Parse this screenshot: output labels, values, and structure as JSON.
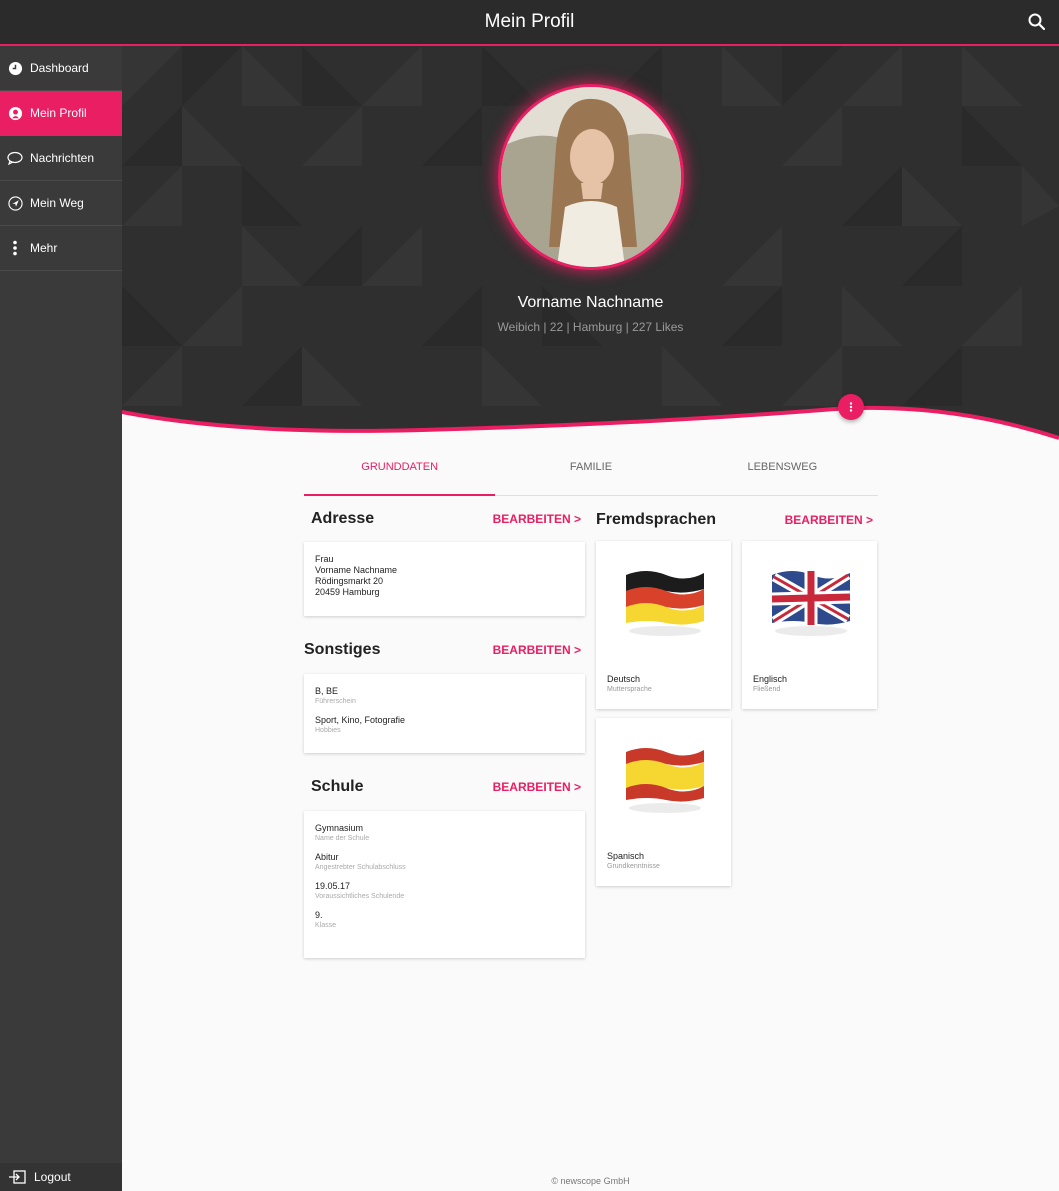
{
  "header": {
    "title": "Mein Profil"
  },
  "sidebar": {
    "items": [
      {
        "label": "Dashboard"
      },
      {
        "label": "Mein Profil"
      },
      {
        "label": "Nachrichten"
      },
      {
        "label": "Mein Weg"
      },
      {
        "label": "Mehr"
      }
    ],
    "logout": "Logout"
  },
  "profile": {
    "name": "Vorname Nachname",
    "subtitle": "Weibich | 22 | Hamburg | 227 Likes"
  },
  "tabs": [
    {
      "label": "GRUNDDATEN"
    },
    {
      "label": "FAMILIE"
    },
    {
      "label": "LEBENSWEG"
    }
  ],
  "address": {
    "title": "Adresse",
    "edit": "BEARBEITEN >",
    "lines": [
      "Frau",
      "Vorname Nachname",
      "Rödingsmarkt 20",
      "20459 Hamburg"
    ]
  },
  "sonstiges": {
    "title": "Sonstiges",
    "edit": "BEARBEITEN >",
    "fields": [
      {
        "value": "B, BE",
        "label": "Führerschein"
      },
      {
        "value": "Sport, Kino, Fotografie",
        "label": "Hobbies"
      }
    ]
  },
  "schule": {
    "title": "Schule",
    "edit": "BEARBEITEN >",
    "fields": [
      {
        "value": "Gymnasium",
        "label": "Name der Schule"
      },
      {
        "value": "Abitur",
        "label": "Angestrebter Schulabschluss"
      },
      {
        "value": "19.05.17",
        "label": "Voraussichtliches Schulende"
      },
      {
        "value": "9.",
        "label": "Klasse"
      }
    ]
  },
  "languages": {
    "title": "Fremdsprachen",
    "edit": "BEARBEITEN >",
    "items": [
      {
        "name": "Deutsch",
        "level": "Muttersprache",
        "flag": "germany-flag"
      },
      {
        "name": "Englisch",
        "level": "Fließend",
        "flag": "uk-flag"
      },
      {
        "name": "Spanisch",
        "level": "Grundkenntnisse",
        "flag": "spain-flag"
      }
    ]
  },
  "footer": "© newscope GmbH",
  "colors": {
    "accent": "#e91e63",
    "topbar": "#2b2b2b",
    "sidebar": "#3a3a3a",
    "hero": "#2f2f2f"
  }
}
